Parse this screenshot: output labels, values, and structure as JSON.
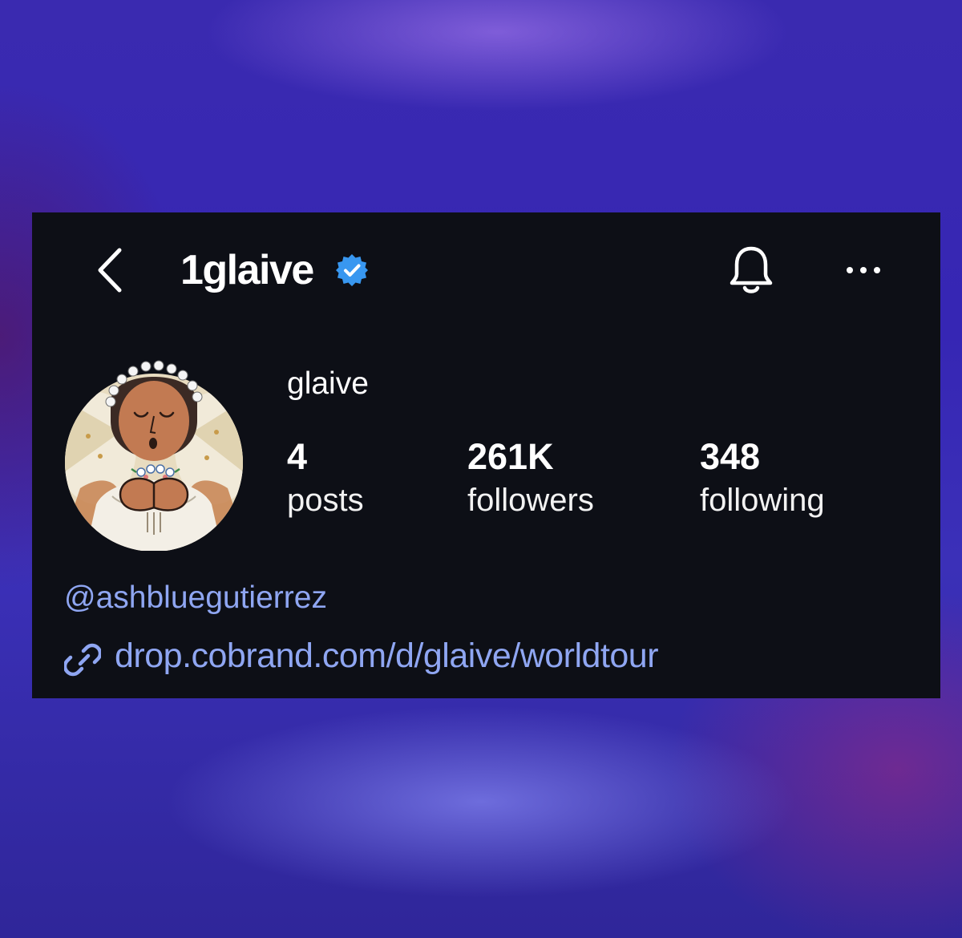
{
  "header": {
    "username": "1glaive",
    "back_icon": "chevron-left-icon",
    "verified_icon": "verified-badge-icon",
    "notifications_icon": "bell-icon",
    "more_icon": "more-horizontal-icon"
  },
  "profile": {
    "display_name": "glaive",
    "avatar": "painted-angel-avatar"
  },
  "stats": {
    "posts": {
      "value": "4",
      "label": "posts"
    },
    "followers": {
      "value": "261K",
      "label": "followers"
    },
    "following": {
      "value": "348",
      "label": "following"
    }
  },
  "bio": {
    "mention": "@ashbluegutierrez",
    "link_icon": "link-icon",
    "link": "drop.cobrand.com/d/glaive/worldtour"
  },
  "colors": {
    "panel_background": "#0d0f16",
    "link_color": "#8fa6f2",
    "verified_blue": "#3897f0",
    "text_primary": "#ffffff"
  }
}
